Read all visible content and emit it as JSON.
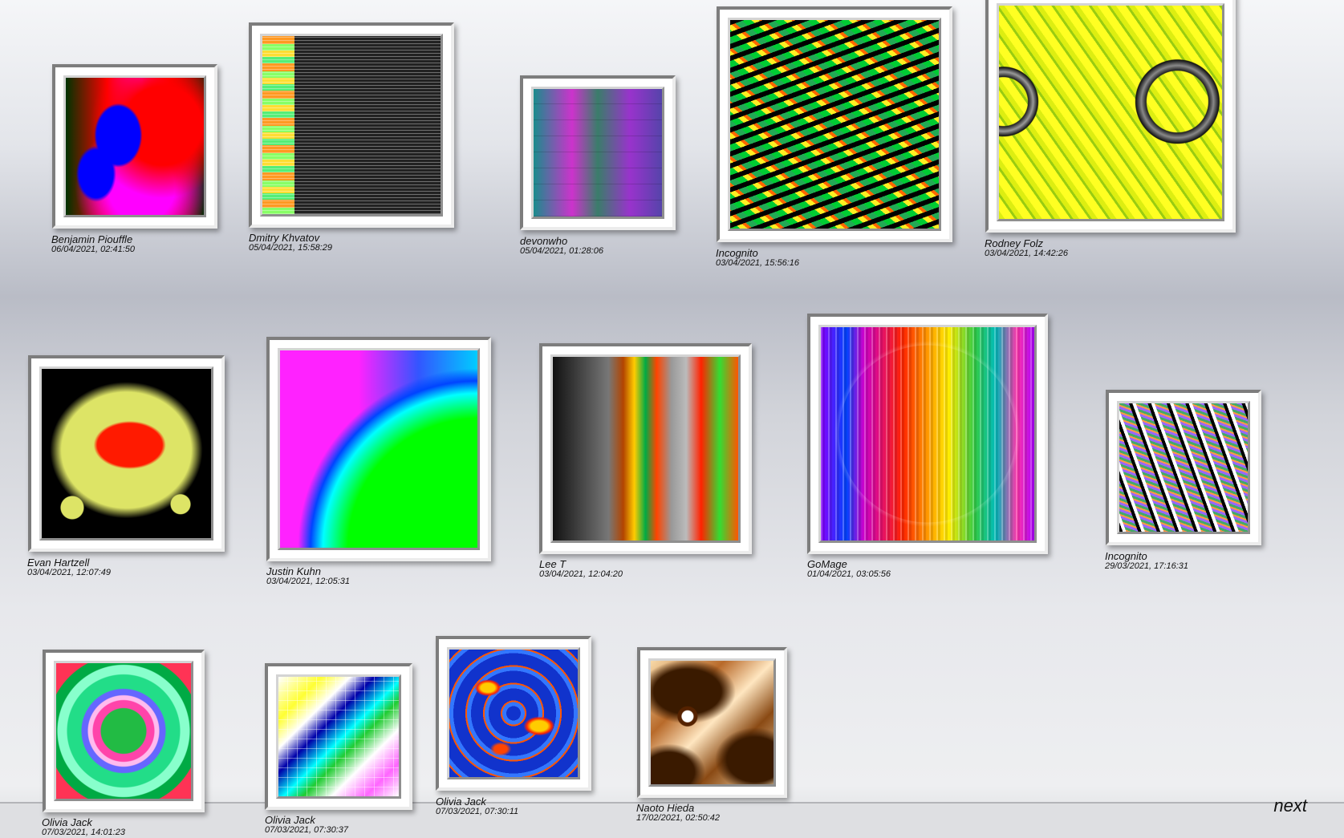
{
  "gallery": [
    {
      "author": "Benjamin Piouffle",
      "date": "06/04/2021, 02:41:50"
    },
    {
      "author": "Dmitry Khvatov",
      "date": "05/04/2021, 15:58:29"
    },
    {
      "author": "devonwho",
      "date": "05/04/2021, 01:28:06"
    },
    {
      "author": "Incognito",
      "date": "03/04/2021, 15:56:16"
    },
    {
      "author": "Rodney Folz",
      "date": "03/04/2021, 14:42:26"
    },
    {
      "author": "Evan Hartzell",
      "date": "03/04/2021, 12:07:49"
    },
    {
      "author": "Justin Kuhn",
      "date": "03/04/2021, 12:05:31"
    },
    {
      "author": "Lee T",
      "date": "03/04/2021, 12:04:20"
    },
    {
      "author": "GoMage",
      "date": "01/04/2021, 03:05:56"
    },
    {
      "author": "Incognito",
      "date": "29/03/2021, 17:16:31"
    },
    {
      "author": "Olivia Jack",
      "date": "07/03/2021, 14:01:23"
    },
    {
      "author": "Olivia Jack",
      "date": "07/03/2021, 07:30:37"
    },
    {
      "author": "Olivia Jack",
      "date": "07/03/2021, 07:30:11"
    },
    {
      "author": "Naoto Hieda",
      "date": "17/02/2021, 02:50:42"
    }
  ],
  "pagination": {
    "next_label": "next"
  }
}
